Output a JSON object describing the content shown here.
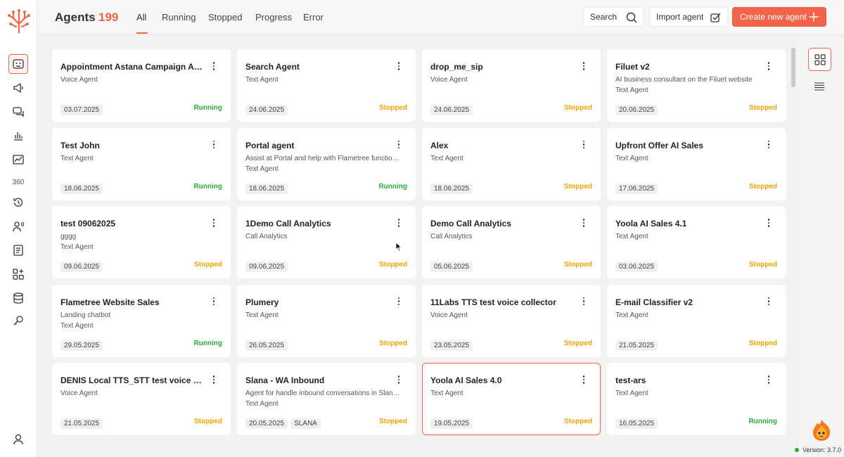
{
  "header": {
    "title": "Agents",
    "count": "199",
    "tabs": [
      {
        "label": "All"
      },
      {
        "label": "Running"
      },
      {
        "label": "Stopped"
      },
      {
        "label": "Progress"
      },
      {
        "label": "Error"
      }
    ],
    "search_label": "Search",
    "import_label": "Import agent",
    "create_label": "Create new agent"
  },
  "sidebar": {
    "label_360": "360"
  },
  "colors": {
    "accent": "#f2644a",
    "running": "#2eaa3a",
    "stopped": "#f0a300"
  },
  "agents": [
    {
      "name": "Appointment Astana Campaign Agent...",
      "line1": "Voice Agent",
      "line2": "",
      "date": "03.07.2025",
      "tag": "",
      "status": "Running"
    },
    {
      "name": "Search Agent",
      "line1": "Text Agent",
      "line2": "",
      "date": "24.06.2025",
      "tag": "",
      "status": "Stopped"
    },
    {
      "name": "drop_me_sip",
      "line1": "Voice Agent",
      "line2": "",
      "date": "24.06.2025",
      "tag": "",
      "status": "Stopped"
    },
    {
      "name": "Filuet v2",
      "line1": "AI business consultant on the Filuet website",
      "line2": "Text Agent",
      "date": "20.06.2025",
      "tag": "",
      "status": "Stopped"
    },
    {
      "name": "Test John",
      "line1": "Text Agent",
      "line2": "",
      "date": "18.06.2025",
      "tag": "",
      "status": "Running"
    },
    {
      "name": "Portal agent",
      "line1": "Assist at Portal and help with Flametree functional...",
      "line2": "Text Agent",
      "date": "18.06.2025",
      "tag": "",
      "status": "Running"
    },
    {
      "name": "Alex",
      "line1": "Text Agent",
      "line2": "",
      "date": "18.06.2025",
      "tag": "",
      "status": "Stopped"
    },
    {
      "name": "Upfront Offer AI Sales",
      "line1": "Text Agent",
      "line2": "",
      "date": "17.06.2025",
      "tag": "",
      "status": "Stopped"
    },
    {
      "name": "test 09062025",
      "line1": "gggg",
      "line2": "Text Agent",
      "date": "09.06.2025",
      "tag": "",
      "status": "Stopped"
    },
    {
      "name": "1Demo Call Analytics",
      "line1": "Call Analytics",
      "line2": "",
      "date": "09.06.2025",
      "tag": "",
      "status": "Stopped"
    },
    {
      "name": "Demo Call Analytics",
      "line1": "Call Analytics",
      "line2": "",
      "date": "05.06.2025",
      "tag": "",
      "status": "Stopped"
    },
    {
      "name": "Yoola AI Sales 4.1",
      "line1": "Text Agent",
      "line2": "",
      "date": "03.06.2025",
      "tag": "",
      "status": "Stopped"
    },
    {
      "name": "Flametree Website Sales",
      "line1": "Landing chatbot",
      "line2": "Text Agent",
      "date": "29.05.2025",
      "tag": "",
      "status": "Running"
    },
    {
      "name": "Plumery",
      "line1": "Text Agent",
      "line2": "",
      "date": "26.05.2025",
      "tag": "",
      "status": "Stopped"
    },
    {
      "name": "11Labs TTS test voice collector",
      "line1": "Voice Agent",
      "line2": "",
      "date": "23.05.2025",
      "tag": "",
      "status": "Stopped"
    },
    {
      "name": "E-mail Classifier v2",
      "line1": "Text Agent",
      "line2": "",
      "date": "21.05.2025",
      "tag": "",
      "status": "Stopped"
    },
    {
      "name": "DENIS Local TTS_STT test voice colle...",
      "line1": "Voice Agent",
      "line2": "",
      "date": "21.05.2025",
      "tag": "",
      "status": "Stopped"
    },
    {
      "name": "Slana - WA Inbound",
      "line1": "Agent for handle inbound conversations in Slana W...",
      "line2": "Text Agent",
      "date": "20.05.2025",
      "tag": "SLANA",
      "status": "Stopped"
    },
    {
      "name": "Yoola AI Sales 4.0",
      "line1": "Text Agent",
      "line2": "",
      "date": "19.05.2025",
      "tag": "",
      "status": "Stopped",
      "selected": true
    },
    {
      "name": "test-ars",
      "line1": "Text Agent",
      "line2": "",
      "date": "16.05.2025",
      "tag": "",
      "status": "Running"
    }
  ],
  "footer": {
    "version": "Version: 3.7.0"
  }
}
